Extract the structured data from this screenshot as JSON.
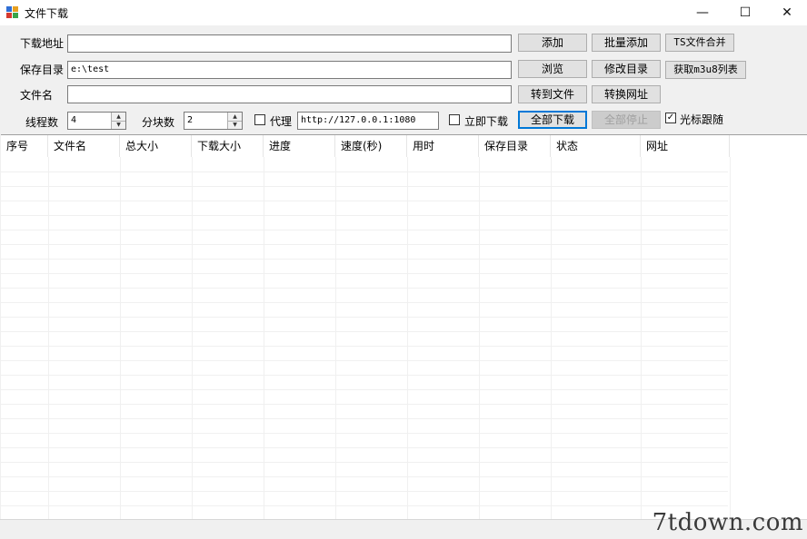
{
  "window": {
    "title": "文件下载",
    "minimize_symbol": "—",
    "maximize_symbol": "☐",
    "close_symbol": "✕"
  },
  "form": {
    "url_label": "下载地址",
    "url_value": "",
    "save_dir_label": "保存目录",
    "save_dir_value": "e:\\test",
    "filename_label": "文件名",
    "filename_value": "",
    "threads_label": "线程数",
    "threads_value": "4",
    "chunks_label": "分块数",
    "chunks_value": "2",
    "proxy_label": "代理",
    "proxy_checked": false,
    "proxy_value": "http://127.0.0.1:1080",
    "immediate_label": "立即下载",
    "immediate_checked": false,
    "cursor_follow_label": "光标跟随",
    "cursor_follow_checked": true
  },
  "buttons": {
    "add": "添加",
    "batch_add": "批量添加",
    "ts_merge": "TS文件合并",
    "browse": "浏览",
    "modify_dir": "修改目录",
    "get_m3u8": "获取m3u8列表",
    "to_file": "转到文件",
    "convert_url": "转换网址",
    "download_all": "全部下载",
    "stop_all": "全部停止"
  },
  "table": {
    "columns": [
      "序号",
      "文件名",
      "总大小",
      "下载大小",
      "进度",
      "速度(秒)",
      "用时",
      "保存目录",
      "状态",
      "网址"
    ],
    "rows": []
  },
  "watermark": "7tdown.com",
  "colors": {
    "accent": "#0078d7",
    "button_bg": "#e1e1e1",
    "window_bg": "#f0f0f0"
  }
}
